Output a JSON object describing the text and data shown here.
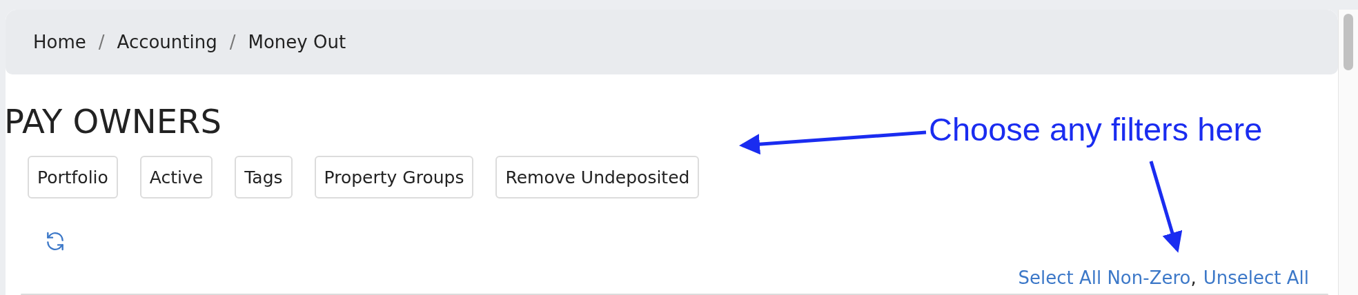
{
  "breadcrumb": [
    {
      "label": "Home"
    },
    {
      "label": "Accounting"
    },
    {
      "label": "Money Out"
    }
  ],
  "breadcrumb_separator": "/",
  "title": "PAY OWNERS",
  "filters": [
    {
      "label": "Portfolio"
    },
    {
      "label": "Active"
    },
    {
      "label": "Tags"
    },
    {
      "label": "Property Groups"
    },
    {
      "label": "Remove Undeposited"
    }
  ],
  "selection_links": [
    {
      "label": "Select All Non-Zero"
    },
    {
      "label": "Unselect All"
    }
  ],
  "selection_separator": ",",
  "annotation": {
    "text": "Choose any filters here"
  }
}
